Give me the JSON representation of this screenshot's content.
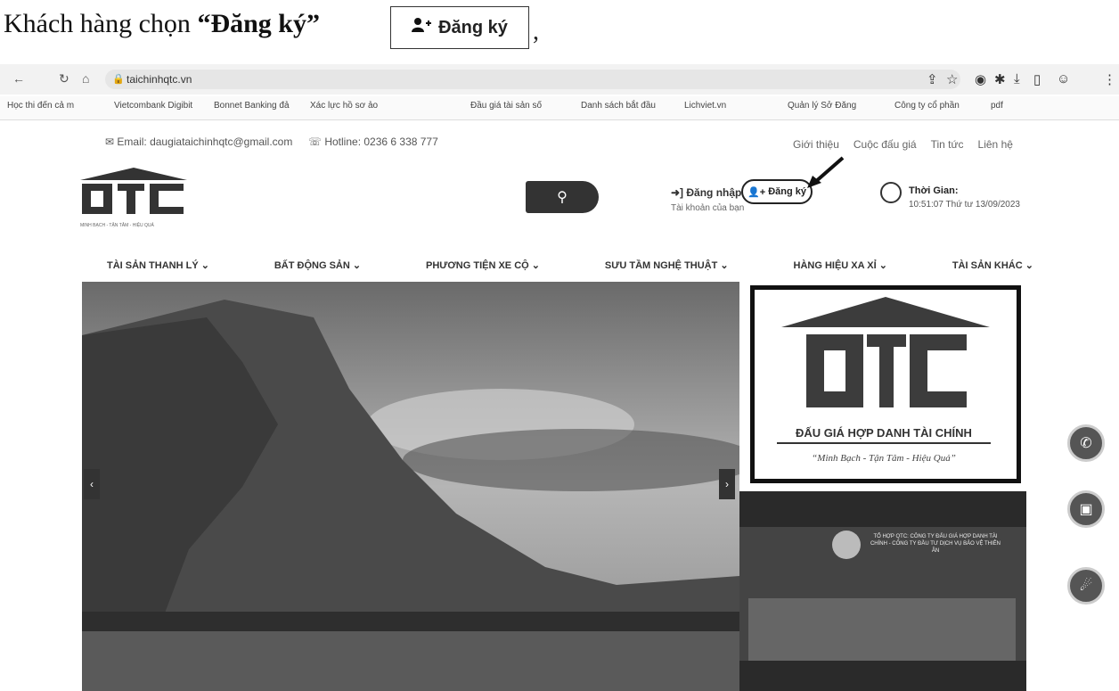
{
  "caption": {
    "text_before": "Khách hàng chọn ",
    "quoted": "“Đăng ký”",
    "button_label": "Đăng ký",
    "comma": ","
  },
  "browser": {
    "url": "taichinhqtc.vn",
    "bookmarks": [
      "Học thi đến cả m",
      "Vietcombank Digibit",
      "Bonnet Banking đả",
      "Xác lực hồ sơ ảo",
      "Đầu giá tài sản số",
      "Danh sách bắt đầu",
      "Lichviet.vn",
      "Quản lý Sở Đăng",
      "Công ty cổ phần",
      "pdf"
    ]
  },
  "topbar": {
    "email": "Email: daugiataichinhqtc@gmail.com",
    "hotline": "Hotline: 0236 6 338 777",
    "links": [
      "Giới thiệu",
      "Cuộc đấu giá",
      "Tin tức",
      "Liên hệ"
    ]
  },
  "header": {
    "login": "Đăng nhập",
    "register": "Đăng ký",
    "account": "Tài khoản của bạn",
    "time_label": "Thời Gian:",
    "time_value": "10:51:07 Thứ tư 13/09/2023",
    "logo_tagline": "MINH BẠCH - TẬN TÂM - HIỆU QUẢ"
  },
  "menu": [
    "TÀI SẢN THANH LÝ",
    "BẤT ĐỘNG SẢN",
    "PHƯƠNG TIỆN XE CỘ",
    "SƯU TẦM NGHỆ THUẬT",
    "HÀNG HIỆU XA XỈ",
    "TÀI SẢN KHÁC"
  ],
  "banner": {
    "name": "ĐẤU GIÁ HỢP DANH TÀI CHÍNH",
    "slogan": "“Minh Bạch - Tận Tâm - Hiệu Quả”"
  },
  "photo": {
    "text": "TỔ HỢP QTC: CÔNG TY ĐẤU GIÁ HỢP DANH TÀI CHÍNH - CÔNG TY ĐẦU TƯ DỊCH VỤ BẢO VỆ THIÊN ÂN"
  }
}
